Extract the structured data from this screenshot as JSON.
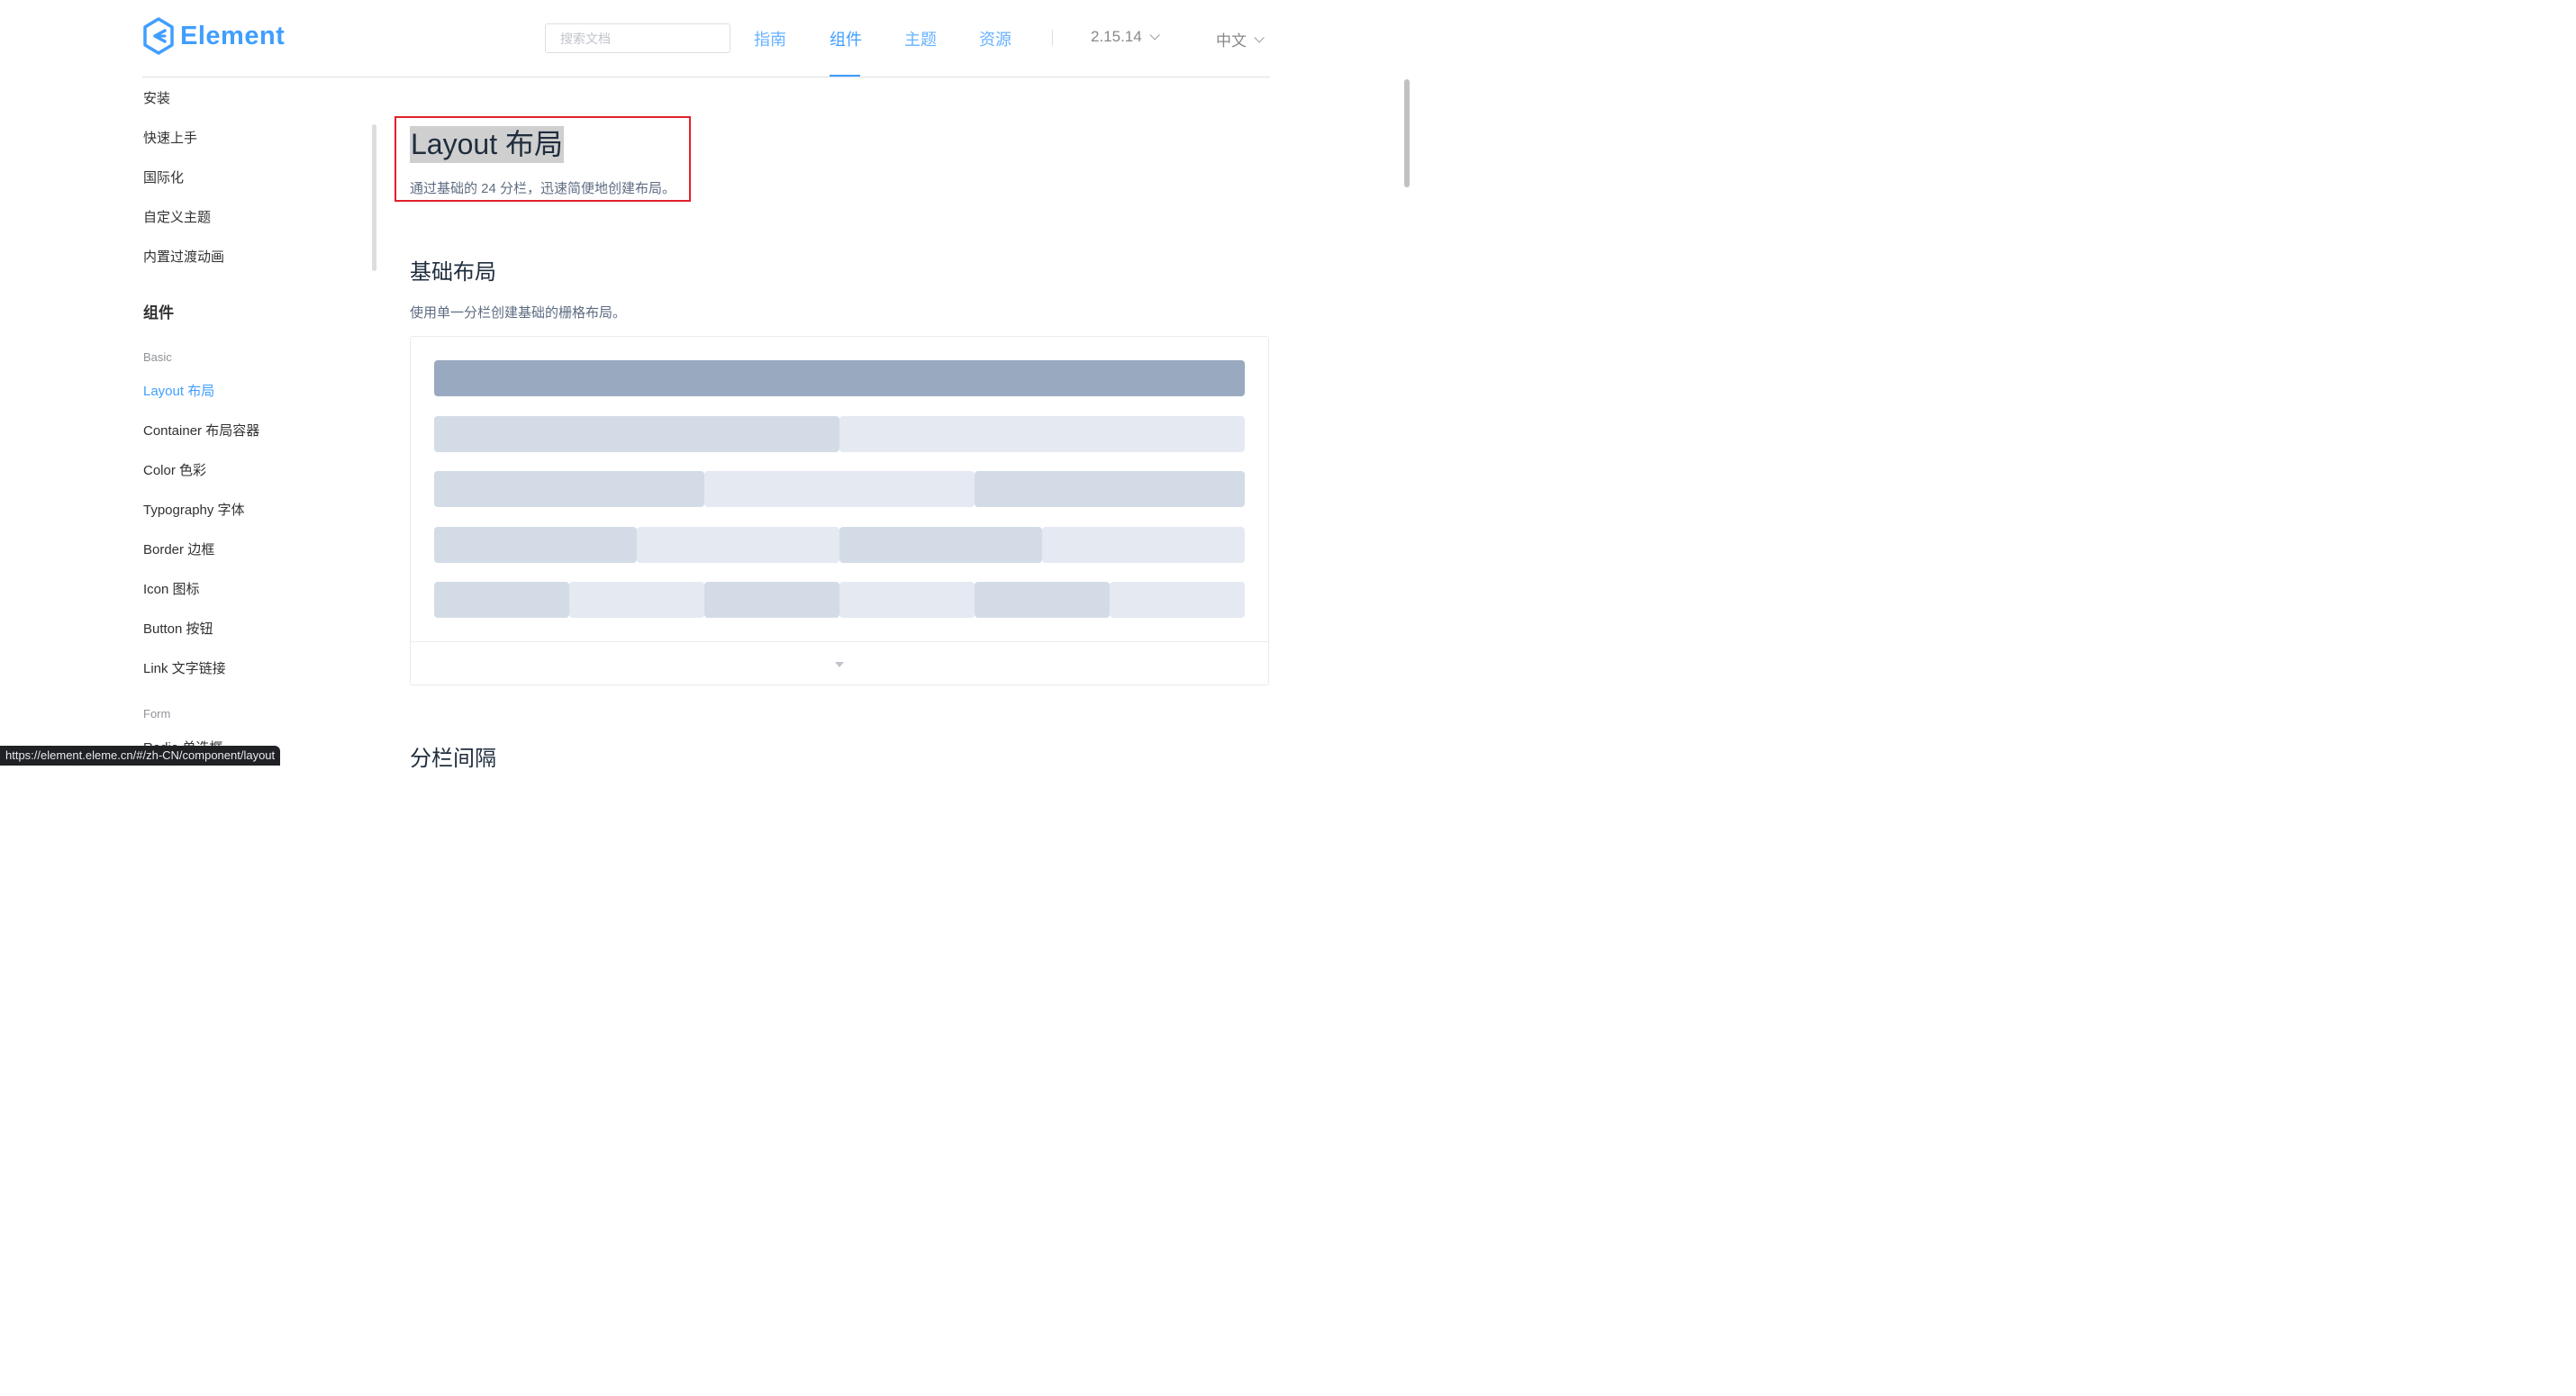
{
  "header": {
    "logo_text": "Element",
    "search_placeholder": "搜索文档",
    "nav": [
      "指南",
      "组件",
      "主题",
      "资源"
    ],
    "active_nav": "组件",
    "version": "2.15.14",
    "language": "中文",
    "brand_color": "#409eff"
  },
  "sidebar": {
    "guide_items": [
      "安装",
      "快速上手",
      "国际化",
      "自定义主题",
      "内置过渡动画"
    ],
    "group_title": "组件",
    "category_basic": "Basic",
    "basic_items": [
      "Layout 布局",
      "Container 布局容器",
      "Color 色彩",
      "Typography 字体",
      "Border 边框",
      "Icon 图标",
      "Button 按钮",
      "Link 文字链接"
    ],
    "active_item": "Layout 布局",
    "category_form": "Form",
    "form_items": [
      "Radio 单选框"
    ]
  },
  "main": {
    "title": "Layout 布局",
    "subtitle": "通过基础的 24 分栏，迅速简便地创建布局。",
    "section1_title": "基础布局",
    "section1_desc": "使用单一分栏创建基础的栅格布局。",
    "section2_title": "分栏间隔",
    "demo_rows": [
      [
        24
      ],
      [
        12,
        12
      ],
      [
        8,
        8,
        8
      ],
      [
        6,
        6,
        6,
        6
      ],
      [
        4,
        4,
        4,
        4,
        4,
        4
      ]
    ]
  },
  "status_bar": {
    "url": "https://element.eleme.cn/#/zh-CN/component/layout"
  }
}
